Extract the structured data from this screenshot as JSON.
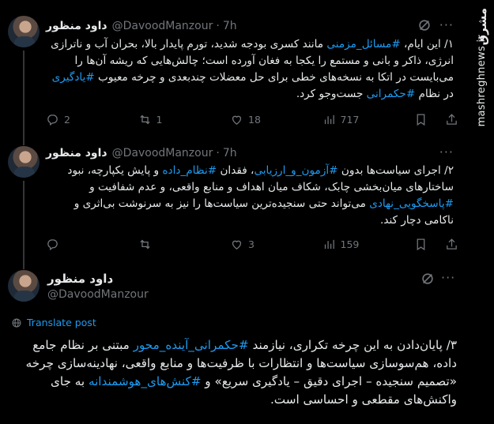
{
  "tweets": [
    {
      "name": "داود منظور",
      "handle": "@DavoodManzour",
      "time": "7h",
      "text_parts": [
        {
          "t": "۱/ این ایام، ",
          "tag": false
        },
        {
          "t": "#مسائل_مزمنی",
          "tag": true
        },
        {
          "t": " مانند کسری بودجه شدید، تورم پایدار بالا، بحران آب و ناترازی انرژی، ذاکر و بانی و مستمع را یکجا به فغان آورده است؛ چالش‌هایی که ریشه آن‌ها را می‌بایست در اتکا به نسخه‌های خطی برای حل معضلات چندبعدی و چرخه معیوب ",
          "tag": false
        },
        {
          "t": "#یادگیری",
          "tag": true
        },
        {
          "t": " در نظام ",
          "tag": false
        },
        {
          "t": "#حکمرانی",
          "tag": true
        },
        {
          "t": " جست‌وجو کرد.",
          "tag": false
        }
      ],
      "stats": {
        "replies": "2",
        "retweets": "1",
        "likes": "18",
        "views": "717"
      }
    },
    {
      "name": "داود منظور",
      "handle": "@DavoodManzour",
      "time": "7h",
      "text_parts": [
        {
          "t": "۲/ اجرای سیاست‌ها بدون ",
          "tag": false
        },
        {
          "t": "#آزمون_و_ارزیابی",
          "tag": true
        },
        {
          "t": "، فقدان ",
          "tag": false
        },
        {
          "t": "#نظام_داده",
          "tag": true
        },
        {
          "t": " و پایش یکپارچه، نبود ساختارهای میان‌بخشی چابک، شکاف میان اهداف و منابع واقعی، و عدم شفافیت و ",
          "tag": false
        },
        {
          "t": "#پاسخگویی_نهادی",
          "tag": true
        },
        {
          "t": " می‌تواند حتی سنجیده‌ترین سیاست‌ها را نیز به سرنوشت بی‌اثری و ناکامی دچار کند.",
          "tag": false
        }
      ],
      "stats": {
        "replies": "",
        "retweets": "",
        "likes": "3",
        "views": "159"
      }
    }
  ],
  "main_tweet": {
    "name": "داود منظور",
    "handle": "@DavoodManzour",
    "translate_label": "Translate post",
    "text_parts": [
      {
        "t": "۳/ پایان‌دادن به این چرخه تکراری، نیازمند ",
        "tag": false
      },
      {
        "t": "#حکمرانی_آینده_محور",
        "tag": true
      },
      {
        "t": " مبتنی بر نظام جامع داده، هم‌سوسازی سیاست‌ها و انتظارات با ظرفیت‌ها و منابع واقعی، نهادینه‌سازی چرخه «تصمیم سنجیده – اجرای دقیق – یادگیری سریع» و ",
        "tag": false
      },
      {
        "t": "#کنش‌های_هوشمندانه",
        "tag": true
      },
      {
        "t": " به جای واکنش‌های مقطعی و احساسی است.",
        "tag": false
      }
    ]
  },
  "watermark": {
    "logo": "مشرق",
    "url": "mashreghnews.ir"
  },
  "colors": {
    "accent": "#1d9bf0",
    "muted": "#71767b",
    "text": "#e7e9ea",
    "background": "#000000"
  }
}
